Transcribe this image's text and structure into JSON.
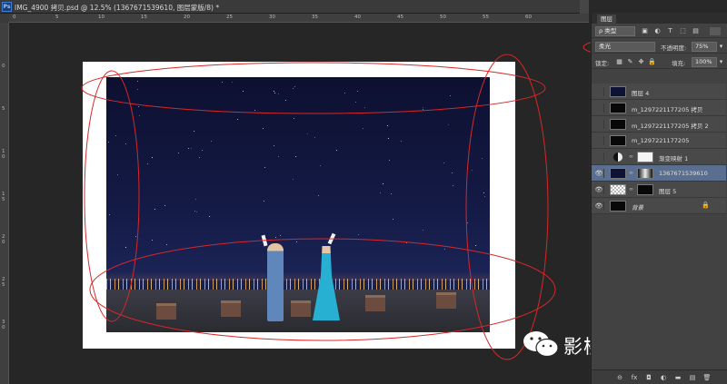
{
  "document": {
    "badge": "Ps",
    "title": "IMG_4900 拷贝.psd @ 12.5% (1367671539610, 图层蒙版/8) *",
    "ruler_top_ticks": [
      "0",
      "5",
      "10",
      "15",
      "20",
      "25",
      "30",
      "35",
      "40",
      "45",
      "50",
      "55",
      "60"
    ],
    "ruler_left_ticks": [
      "0",
      "5",
      "1 0",
      "1 5",
      "2 0",
      "2 5",
      "3 0"
    ]
  },
  "watermark": {
    "text": "影楼后期微刊",
    "icon": "wechat-icon"
  },
  "annotation_color": "#d62828",
  "panel": {
    "tab": "图层",
    "filter_label": "ρ 类型",
    "filter_icons": [
      "image-filter-icon",
      "adjustment-filter-icon",
      "type-filter-icon",
      "shape-filter-icon",
      "smartobject-filter-icon"
    ],
    "blend_mode": "柔光",
    "opacity_label": "不透明度:",
    "opacity_value": "75%",
    "lock_label": "锁定:",
    "fill_label": "填充:",
    "fill_value": "100%",
    "layers": [
      {
        "name": "图层 4",
        "visible": false,
        "thumb": "dark",
        "mask": null
      },
      {
        "name": "m_1297221177205 拷贝",
        "visible": false,
        "thumb": "black",
        "mask": null
      },
      {
        "name": "m_1297221177205 拷贝 2",
        "visible": false,
        "thumb": "black",
        "mask": null
      },
      {
        "name": "m_1297221177205",
        "visible": false,
        "thumb": "black",
        "mask": null
      },
      {
        "name": "渐变映射 1",
        "visible": false,
        "thumb": "adj",
        "mask": "white"
      },
      {
        "name": "1367671539610",
        "visible": true,
        "thumb": "dark",
        "mask": "grad",
        "selected": true
      },
      {
        "name": "图层 5",
        "visible": true,
        "thumb": "check",
        "mask": "black"
      },
      {
        "name": "背景",
        "visible": true,
        "thumb": "black",
        "mask": null,
        "locked": true,
        "italic": true
      }
    ],
    "bottom_icons": [
      "link-layers-icon",
      "fx-icon",
      "add-mask-icon",
      "new-adjustment-icon",
      "new-group-icon",
      "new-layer-icon",
      "trash-icon"
    ],
    "bottom_glyphs": [
      "⊖",
      "fx",
      "◘",
      "◐",
      "▬",
      "▤",
      "🗑"
    ]
  }
}
